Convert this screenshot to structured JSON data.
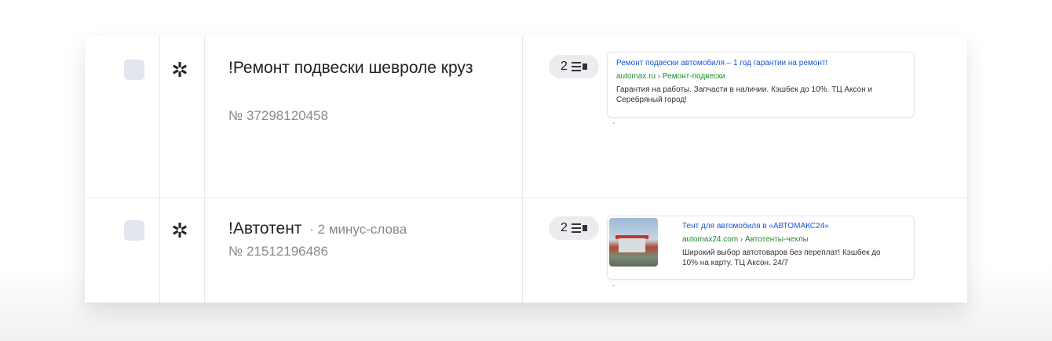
{
  "groups": [
    {
      "title": "!Ремонт подвески шевроле круз",
      "negative_words": "",
      "id_text": "№ 37298120458",
      "ads_count": "2",
      "ad": {
        "title": "Ремонт подвески автомобиля – 1 год гарантии на ремонт!",
        "url": "automax.ru › Ремонт-подвески",
        "description": "Гарантия на работы. Запчасти в наличии. Кэшбек до 10%. ТЦ Аксон и Серебряный город!",
        "has_image": false
      },
      "ad_footer": "-"
    },
    {
      "title": "!Автотент",
      "negative_words": "· 2 минус-слова",
      "id_text": "№ 21512196486",
      "ads_count": "2",
      "ad": {
        "title": "Тент для автомобиля в «АВТОМАКС24»",
        "url": "automax24.com › Автотенты-чехлы",
        "description": "Широкий выбор автотоваров без переплат! Кэшбек до 10% на карту. ТЦ Аксон. 24/7",
        "has_image": true
      },
      "ad_footer": "-"
    }
  ],
  "icons": {
    "settings": "gear-icon",
    "ads": "list-icon"
  },
  "colors": {
    "ad_title": "#1a56d6",
    "ad_url": "#1c8a2e",
    "checkbox": "#e4e6ee"
  }
}
